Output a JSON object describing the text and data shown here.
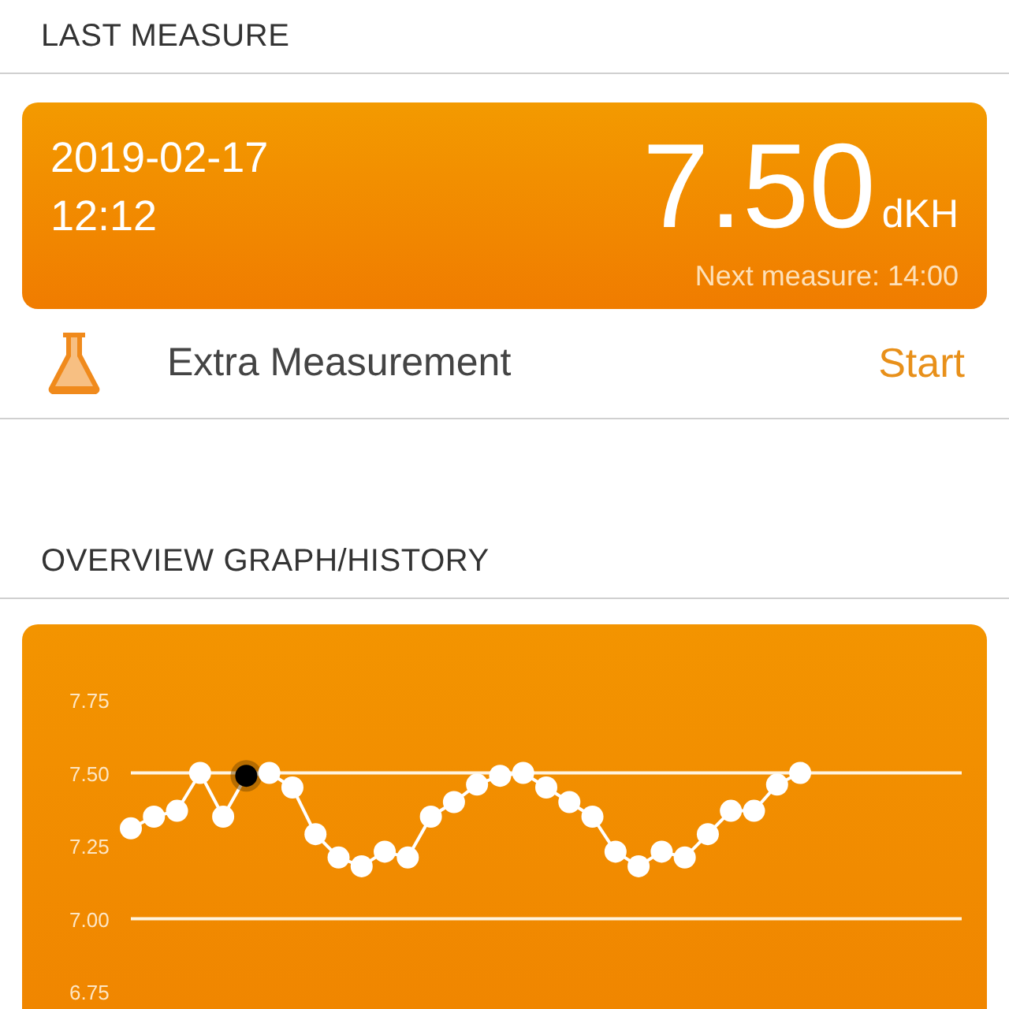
{
  "last_measure": {
    "heading": "LAST MEASURE",
    "date": "2019-02-17",
    "time": "12:12",
    "value": "7.50",
    "unit": "dKH",
    "next": "Next measure: 14:00"
  },
  "extra": {
    "label": "Extra Measurement",
    "action": "Start"
  },
  "overview": {
    "heading": "OVERVIEW GRAPH/HISTORY",
    "points": [
      {
        "selected": false
      },
      {
        "selected": false
      },
      {
        "selected": false
      },
      {
        "selected": false
      },
      {
        "selected": false
      },
      {
        "selected": true
      },
      {
        "selected": false
      },
      {
        "selected": false
      },
      {
        "selected": false
      },
      {
        "selected": false
      },
      {
        "selected": false
      },
      {
        "selected": false
      },
      {
        "selected": false
      },
      {
        "selected": false
      },
      {
        "selected": false
      },
      {
        "selected": false
      },
      {
        "selected": false
      },
      {
        "selected": false
      },
      {
        "selected": false
      },
      {
        "selected": false
      },
      {
        "selected": false
      },
      {
        "selected": false
      },
      {
        "selected": false
      },
      {
        "selected": false
      },
      {
        "selected": false
      },
      {
        "selected": false
      },
      {
        "selected": false
      },
      {
        "selected": false
      },
      {
        "selected": false
      },
      {
        "selected": false
      }
    ],
    "chart_data": {
      "type": "line",
      "ylim": [
        6.75,
        7.75
      ],
      "yticks": [
        {
          "value": 7.75,
          "label": "7.75"
        },
        {
          "value": 7.5,
          "label": "7.50"
        },
        {
          "value": 7.25,
          "label": "7.25"
        },
        {
          "value": 7.0,
          "label": "7.00"
        },
        {
          "value": 6.75,
          "label": "6.75"
        }
      ],
      "ref_lines": [
        {
          "axis": "y",
          "value": 7.5
        },
        {
          "axis": "y",
          "value": 7.0
        }
      ],
      "categories": [
        null,
        null,
        null,
        null,
        null,
        null,
        null,
        null,
        null,
        null,
        null,
        null,
        null,
        null,
        null,
        null,
        null,
        null,
        null,
        null,
        null,
        null,
        null,
        null,
        null,
        null,
        null,
        null,
        null,
        null,
        null,
        null,
        null,
        null,
        null,
        null,
        null
      ],
      "series": [
        {
          "color": "#ffffff",
          "marker": "circle",
          "values": [
            7.31,
            7.35,
            7.37,
            7.5,
            7.35,
            7.49,
            7.5,
            7.45,
            7.29,
            7.21,
            7.18,
            7.23,
            7.21,
            7.35,
            7.4,
            7.46,
            7.49,
            7.5,
            7.45,
            7.4,
            7.35,
            7.23,
            7.18,
            7.23,
            7.21,
            7.29,
            7.37,
            7.37,
            7.46,
            7.5,
            null,
            null,
            null,
            null,
            null,
            null,
            null
          ]
        }
      ]
    }
  }
}
